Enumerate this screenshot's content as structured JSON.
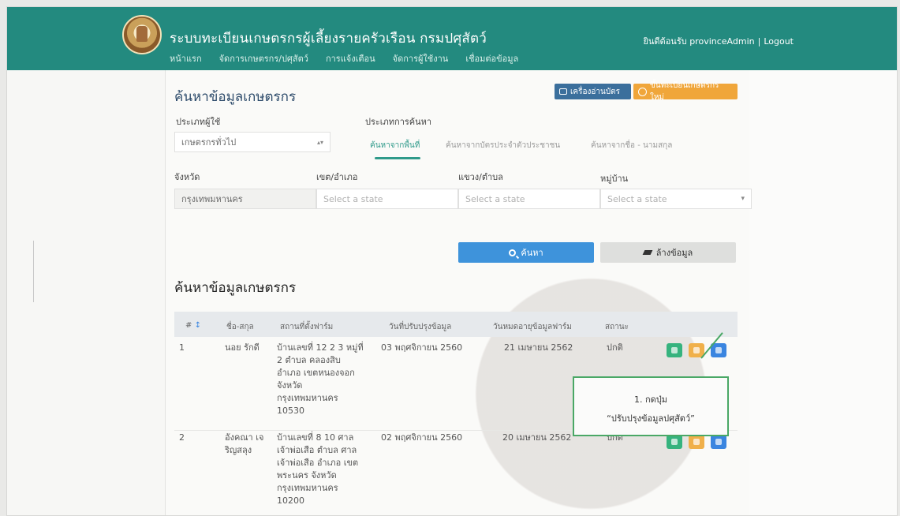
{
  "header": {
    "app_title": "ระบบทะเบียนเกษตรกรผู้เลี้ยงรายครัวเรือน กรมปศุสัตว์",
    "nav": [
      "หน้าแรก",
      "จัดการเกษตรกร/ปศุสัตว์",
      "การแจ้งเตือน",
      "จัดการผู้ใช้งาน",
      "เชื่อมต่อข้อมูล"
    ],
    "welcome": "ยินดีต้อนรับ provinceAdmin",
    "separator": "|",
    "logout": "Logout",
    "colors": {
      "bar": "#238a7f"
    }
  },
  "search": {
    "title": "ค้นหาข้อมูลเกษตรกร",
    "card_reader_button": "เครื่องอ่านบัตร",
    "add_new_button": "ขึ้นทะเบียนเกษตรกรใหม่",
    "user_type_label": "ประเภทผู้ใช้",
    "user_type_value": "เกษตรกรทั่วไป",
    "search_type_label": "ประเภทการค้นหา",
    "tabs": [
      {
        "label": "ค้นหาจากพื้นที่",
        "active": true
      },
      {
        "label": "ค้นหาจากบัตรประจำตัวประชาชน",
        "active": false
      },
      {
        "label": "ค้นหาจากชื่อ - นามสกุล",
        "active": false
      }
    ],
    "province_label": "จังหวัด",
    "province_value": "กรุงเทพมหานคร",
    "district_label": "เขต/อำเภอ",
    "district_placeholder": "Select a state",
    "subdistrict_label": "แขวง/ตำบล",
    "subdistrict_placeholder": "Select a state",
    "village_label": "หมู่บ้าน",
    "village_placeholder": "Select a state",
    "search_button": "ค้นหา",
    "clear_button": "ล้างข้อมูล"
  },
  "results": {
    "title": "ค้นหาข้อมูลเกษตรกร",
    "columns": [
      "#",
      "ชื่อ-สกุล",
      "สถานที่ตั้งฟาร์ม",
      "วันที่ปรับปรุงข้อมูล",
      "วันหมดอายุข้อมูลฟาร์ม",
      "สถานะ"
    ],
    "rows": [
      {
        "no": "1",
        "name": [
          "นอย รักดี"
        ],
        "address": [
          "บ้านเลขที่ 12 2 3 หมู่ที่",
          "2 ตำบล คลองสิบ",
          "อำเภอ เขตหนองจอก",
          "จังหวัด",
          "กรุงเทพมหานคร",
          "10530"
        ],
        "updated": "03 พฤศจิกายน 2560",
        "expires": "21 เมษายน 2562",
        "status": "ปกติ"
      },
      {
        "no": "2",
        "name": [
          "อังคณา เจ",
          "ริญสลุง"
        ],
        "address": [
          "บ้านเลขที่ 8 10 ศาล",
          "เจ้าพ่อเสือ ตำบล ศาล",
          "เจ้าพ่อเสือ อำเภอ เขต",
          "พระนคร จังหวัด",
          "กรุงเทพมหานคร",
          "10200"
        ],
        "updated": "02 พฤศจิกายน 2560",
        "expires": "20 เมษายน 2562",
        "status": "ปกติ"
      }
    ]
  },
  "callout": {
    "line1": "1. กดปุ่ม",
    "line2": "“ปรับปรุงข้อมูลปศุสัตว์”"
  }
}
